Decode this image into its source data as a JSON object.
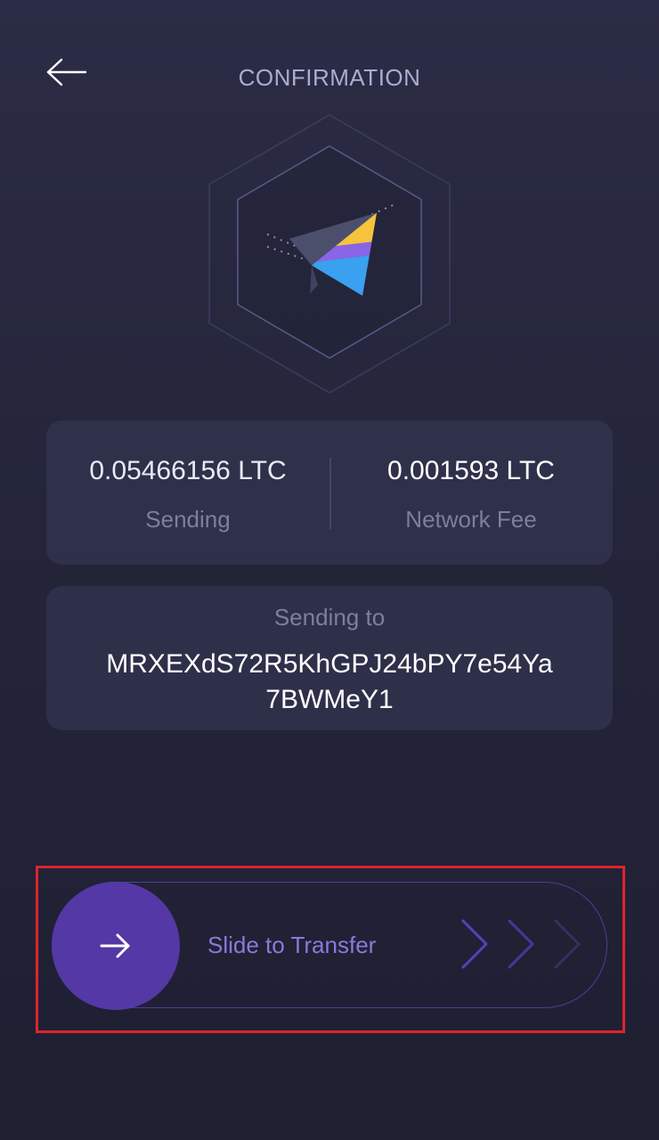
{
  "header": {
    "title": "CONFIRMATION",
    "back_icon": "arrow-left-icon"
  },
  "hero": {
    "icon": "paper-plane-icon"
  },
  "amounts": {
    "sending_value": "0.05466156 LTC",
    "sending_label": "Sending",
    "fee_value": "0.001593 LTC",
    "fee_label": "Network Fee"
  },
  "recipient": {
    "label": "Sending to",
    "address": "MRXEXdS72R5KhGPJ24bPY7e54Ya7BWMeY1"
  },
  "slider": {
    "label": "Slide to Transfer",
    "handle_icon": "arrow-right-icon",
    "hint_icon": "chevrons-right-icon"
  },
  "colors": {
    "background": "#26273d",
    "accent": "#5438a6",
    "slider_text": "#8b79d9",
    "muted_text": "#7d7f9f",
    "title_text": "#a9acd2",
    "highlight": "#e0232d"
  }
}
